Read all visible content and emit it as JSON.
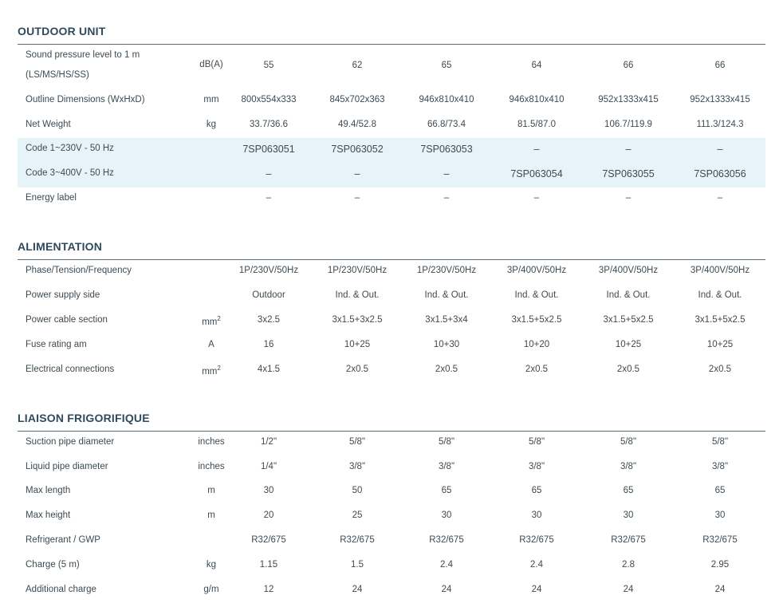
{
  "outdoor": {
    "title": "OUTDOOR UNIT",
    "sound": {
      "label_1": "Sound pressure level to 1 m",
      "label_2": "(LS/MS/HS/SS)",
      "unit": "dB(A)",
      "values": [
        "55",
        "62",
        "65",
        "64",
        "66",
        "66"
      ]
    },
    "dimensions": {
      "label": "Outline Dimensions (WxHxD)",
      "unit": "mm",
      "values": [
        "800x554x333",
        "845x702x363",
        "946x810x410",
        "946x810x410",
        "952x1333x415",
        "952x1333x415"
      ]
    },
    "weight": {
      "label": "Net Weight",
      "unit": "kg",
      "values": [
        "33.7/36.6",
        "49.4/52.8",
        "66.8/73.4",
        "81.5/87.0",
        "106.7/119.9",
        "111.3/124.3"
      ]
    },
    "code1": {
      "label": "Code 1~230V - 50 Hz",
      "values": [
        "7SP063051",
        "7SP063052",
        "7SP063053",
        "–",
        "–",
        "–"
      ]
    },
    "code3": {
      "label": "Code 3~400V - 50 Hz",
      "values": [
        "–",
        "–",
        "–",
        "7SP063054",
        "7SP063055",
        "7SP063056"
      ]
    },
    "energy": {
      "label": "Energy label",
      "values": [
        "–",
        "–",
        "–",
        "–",
        "–",
        "–"
      ]
    }
  },
  "alimentation": {
    "title": "ALIMENTATION",
    "phase": {
      "label": "Phase/Tension/Frequency",
      "values": [
        "1P/230V/50Hz",
        "1P/230V/50Hz",
        "1P/230V/50Hz",
        "3P/400V/50Hz",
        "3P/400V/50Hz",
        "3P/400V/50Hz"
      ]
    },
    "supply": {
      "label": "Power supply side",
      "values": [
        "Outdoor",
        "Ind. & Out.",
        "Ind. & Out.",
        "Ind. & Out.",
        "Ind. & Out.",
        "Ind. & Out."
      ]
    },
    "cable": {
      "label": "Power cable section",
      "unit": "mm",
      "unit_sup": "2",
      "values": [
        "3x2.5",
        "3x1.5+3x2.5",
        "3x1.5+3x4",
        "3x1.5+5x2.5",
        "3x1.5+5x2.5",
        "3x1.5+5x2.5"
      ]
    },
    "fuse": {
      "label": "Fuse rating am",
      "unit": "A",
      "values": [
        "16",
        "10+25",
        "10+30",
        "10+20",
        "10+25",
        "10+25"
      ]
    },
    "electrical": {
      "label": "Electrical connections",
      "unit": "mm",
      "unit_sup": "2",
      "values": [
        "4x1.5",
        "2x0.5",
        "2x0.5",
        "2x0.5",
        "2x0.5",
        "2x0.5"
      ]
    }
  },
  "liaison": {
    "title": "LIAISON FRIGORIFIQUE",
    "suction": {
      "label": "Suction pipe diameter",
      "unit": "inches",
      "values": [
        "1/2\"",
        "5/8\"",
        "5/8\"",
        "5/8\"",
        "5/8\"",
        "5/8\""
      ]
    },
    "liquid": {
      "label": "Liquid pipe diameter",
      "unit": "inches",
      "values": [
        "1/4\"",
        "3/8\"",
        "3/8\"",
        "3/8\"",
        "3/8\"",
        "3/8\""
      ]
    },
    "maxlength": {
      "label": "Max length",
      "unit": "m",
      "values": [
        "30",
        "50",
        "65",
        "65",
        "65",
        "65"
      ]
    },
    "maxheight": {
      "label": "Max height",
      "unit": "m",
      "values": [
        "20",
        "25",
        "30",
        "30",
        "30",
        "30"
      ]
    },
    "refrigerant": {
      "label": "Refrigerant / GWP",
      "values": [
        "R32/675",
        "R32/675",
        "R32/675",
        "R32/675",
        "R32/675",
        "R32/675"
      ]
    },
    "charge": {
      "label": "Charge (5 m)",
      "unit": "kg",
      "values": [
        "1.15",
        "1.5",
        "2.4",
        "2.4",
        "2.8",
        "2.95"
      ]
    },
    "additional": {
      "label": "Additional charge",
      "unit": "g/m",
      "values": [
        "12",
        "24",
        "24",
        "24",
        "24",
        "24"
      ]
    }
  }
}
